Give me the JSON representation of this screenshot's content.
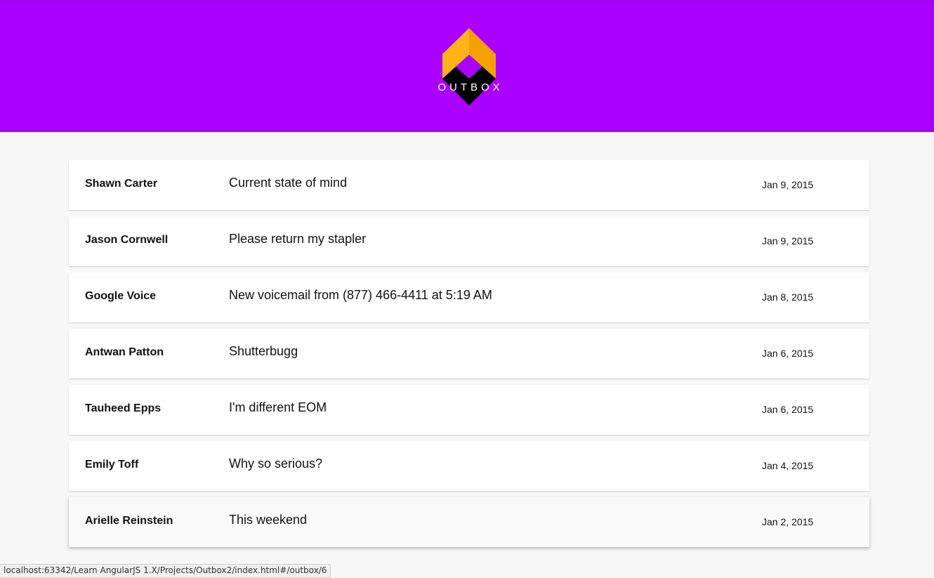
{
  "header": {
    "logo_text": "OUTBOX",
    "background_color": "#aa00ff",
    "logo_colors": {
      "left": "#ffb51a",
      "right": "#f5a000",
      "bottom": "#000000",
      "center": "#aa00ff"
    }
  },
  "messages": [
    {
      "sender": "Shawn Carter",
      "subject": "Current state of mind",
      "date": "Jan 9, 2015"
    },
    {
      "sender": "Jason Cornwell",
      "subject": "Please return my stapler",
      "date": "Jan 9, 2015"
    },
    {
      "sender": "Google Voice",
      "subject": "New voicemail from (877) 466-4411 at 5:19 AM",
      "date": "Jan 8, 2015"
    },
    {
      "sender": "Antwan Patton",
      "subject": "Shutterbugg",
      "date": "Jan 6, 2015"
    },
    {
      "sender": "Tauheed Epps",
      "subject": "I'm different EOM",
      "date": "Jan 6, 2015"
    },
    {
      "sender": "Emily Toff",
      "subject": "Why so serious?",
      "date": "Jan 4, 2015"
    },
    {
      "sender": "Arielle Reinstein",
      "subject": "This weekend",
      "date": "Jan 2, 2015"
    }
  ],
  "status_bar": {
    "url": "localhost:63342/Learn AngularJS 1.X/Projects/Outbox2/index.html#/outbox/6"
  }
}
